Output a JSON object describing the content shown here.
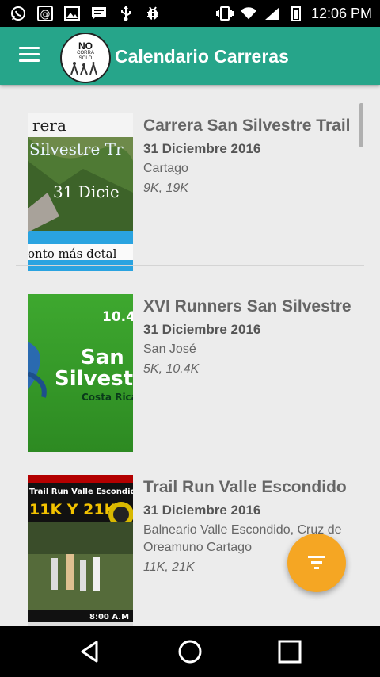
{
  "status_bar": {
    "time": "12:06 PM",
    "left_icons": [
      "whatsapp-icon",
      "at-sign-icon",
      "image-icon",
      "message-icon",
      "usb-icon",
      "android-debug-icon"
    ],
    "right_icons": [
      "vibrate-icon",
      "wifi-icon",
      "signal-icon",
      "battery-icon"
    ]
  },
  "app_bar": {
    "title": "Calendario Carreras",
    "logo": {
      "line1": "NO",
      "line2": "CORRA",
      "line3": "SOLO"
    },
    "colors": {
      "bar": "#26a58a"
    }
  },
  "races": [
    {
      "title": "Carrera San Silvestre Trail",
      "date": "31 Diciembre 2016",
      "place": "Cartago",
      "distances": "9K, 19K",
      "thumb_text": {
        "t1": "rera",
        "t2": "Silvestre Tr",
        "t3": "31 Dicie",
        "t4": "onto más detal"
      }
    },
    {
      "title": "XVI Runners San Silvestre",
      "date": "31 Diciembre 2016",
      "place": "San José",
      "distances": "5K, 10.4K",
      "thumb_text": {
        "t1": "10.4",
        "t2": "San",
        "t3": "Silvestre",
        "t4": "Costa Rica"
      }
    },
    {
      "title": "Trail Run Valle Escondido",
      "date": "31 Diciembre 2016",
      "place": "Balneario Valle Escondido, Cruz de Oreamuno Cartago",
      "distances": "11K, 21K",
      "thumb_text": {
        "t1": "Trail Run Valle Escondido",
        "t2": "11K Y 21K",
        "t3": "8:00 A.M"
      }
    }
  ],
  "fab": {
    "icon": "filter-icon",
    "color": "#f5a623"
  },
  "nav_bar": {
    "icons": [
      "back-icon",
      "home-icon",
      "recents-icon"
    ]
  }
}
